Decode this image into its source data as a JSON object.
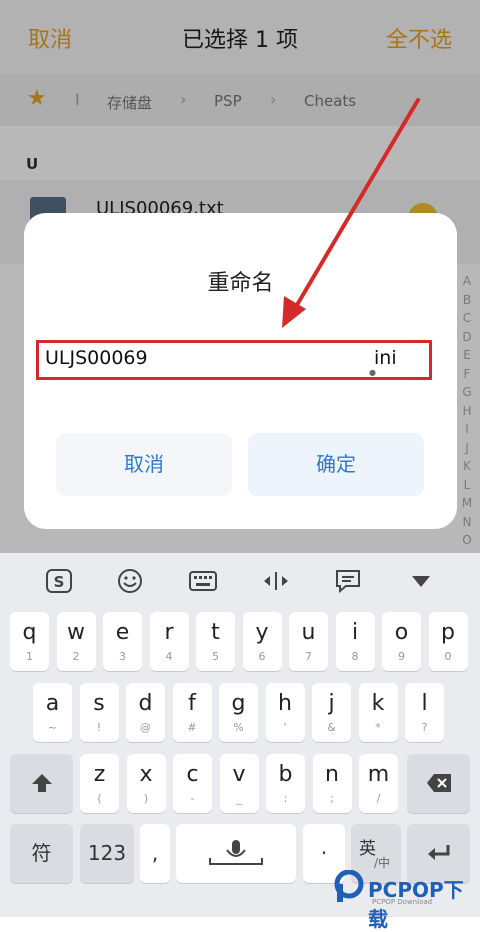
{
  "header": {
    "cancel": "取消",
    "title": "已选择 1 项",
    "deselect": "全不选"
  },
  "breadcrumb": {
    "items": [
      "存储盘",
      "PSP",
      "Cheats"
    ],
    "separator_first": "I",
    "separator": "›"
  },
  "section_letter": "U",
  "file": {
    "name": "ULJS00069.txt"
  },
  "index_letters": [
    "A",
    "B",
    "C",
    "D",
    "E",
    "F",
    "G",
    "H",
    "I",
    "J",
    "K",
    "L",
    "M",
    "N",
    "O"
  ],
  "dialog": {
    "title": "重命名",
    "input_value": "ULJS00069",
    "input_extension": "ini",
    "cancel": "取消",
    "confirm": "确定"
  },
  "keyboard": {
    "row1": [
      {
        "k": "q",
        "s": "1"
      },
      {
        "k": "w",
        "s": "2"
      },
      {
        "k": "e",
        "s": "3"
      },
      {
        "k": "r",
        "s": "4"
      },
      {
        "k": "t",
        "s": "5"
      },
      {
        "k": "y",
        "s": "6"
      },
      {
        "k": "u",
        "s": "7"
      },
      {
        "k": "i",
        "s": "8"
      },
      {
        "k": "o",
        "s": "9"
      },
      {
        "k": "p",
        "s": "0"
      }
    ],
    "row2": [
      {
        "k": "a",
        "s": "~"
      },
      {
        "k": "s",
        "s": "!"
      },
      {
        "k": "d",
        "s": "@"
      },
      {
        "k": "f",
        "s": "#"
      },
      {
        "k": "g",
        "s": "%"
      },
      {
        "k": "h",
        "s": "'"
      },
      {
        "k": "j",
        "s": "&"
      },
      {
        "k": "k",
        "s": "*"
      },
      {
        "k": "l",
        "s": "?"
      }
    ],
    "row3": [
      {
        "k": "z",
        "s": "("
      },
      {
        "k": "x",
        "s": ")"
      },
      {
        "k": "c",
        "s": "-"
      },
      {
        "k": "v",
        "s": "_"
      },
      {
        "k": "b",
        "s": ":"
      },
      {
        "k": "n",
        "s": ";"
      },
      {
        "k": "m",
        "s": "/"
      }
    ],
    "symbols": "符",
    "numbers": "123",
    "comma": ",",
    "period": "·",
    "lang_main": "英",
    "lang_sub": "/中"
  },
  "watermark": {
    "text": "PCPOP下载",
    "sub": "PCPOP Download"
  },
  "colors": {
    "accent": "#e8a325",
    "link": "#2f78d6",
    "highlight": "#d42a2a"
  }
}
